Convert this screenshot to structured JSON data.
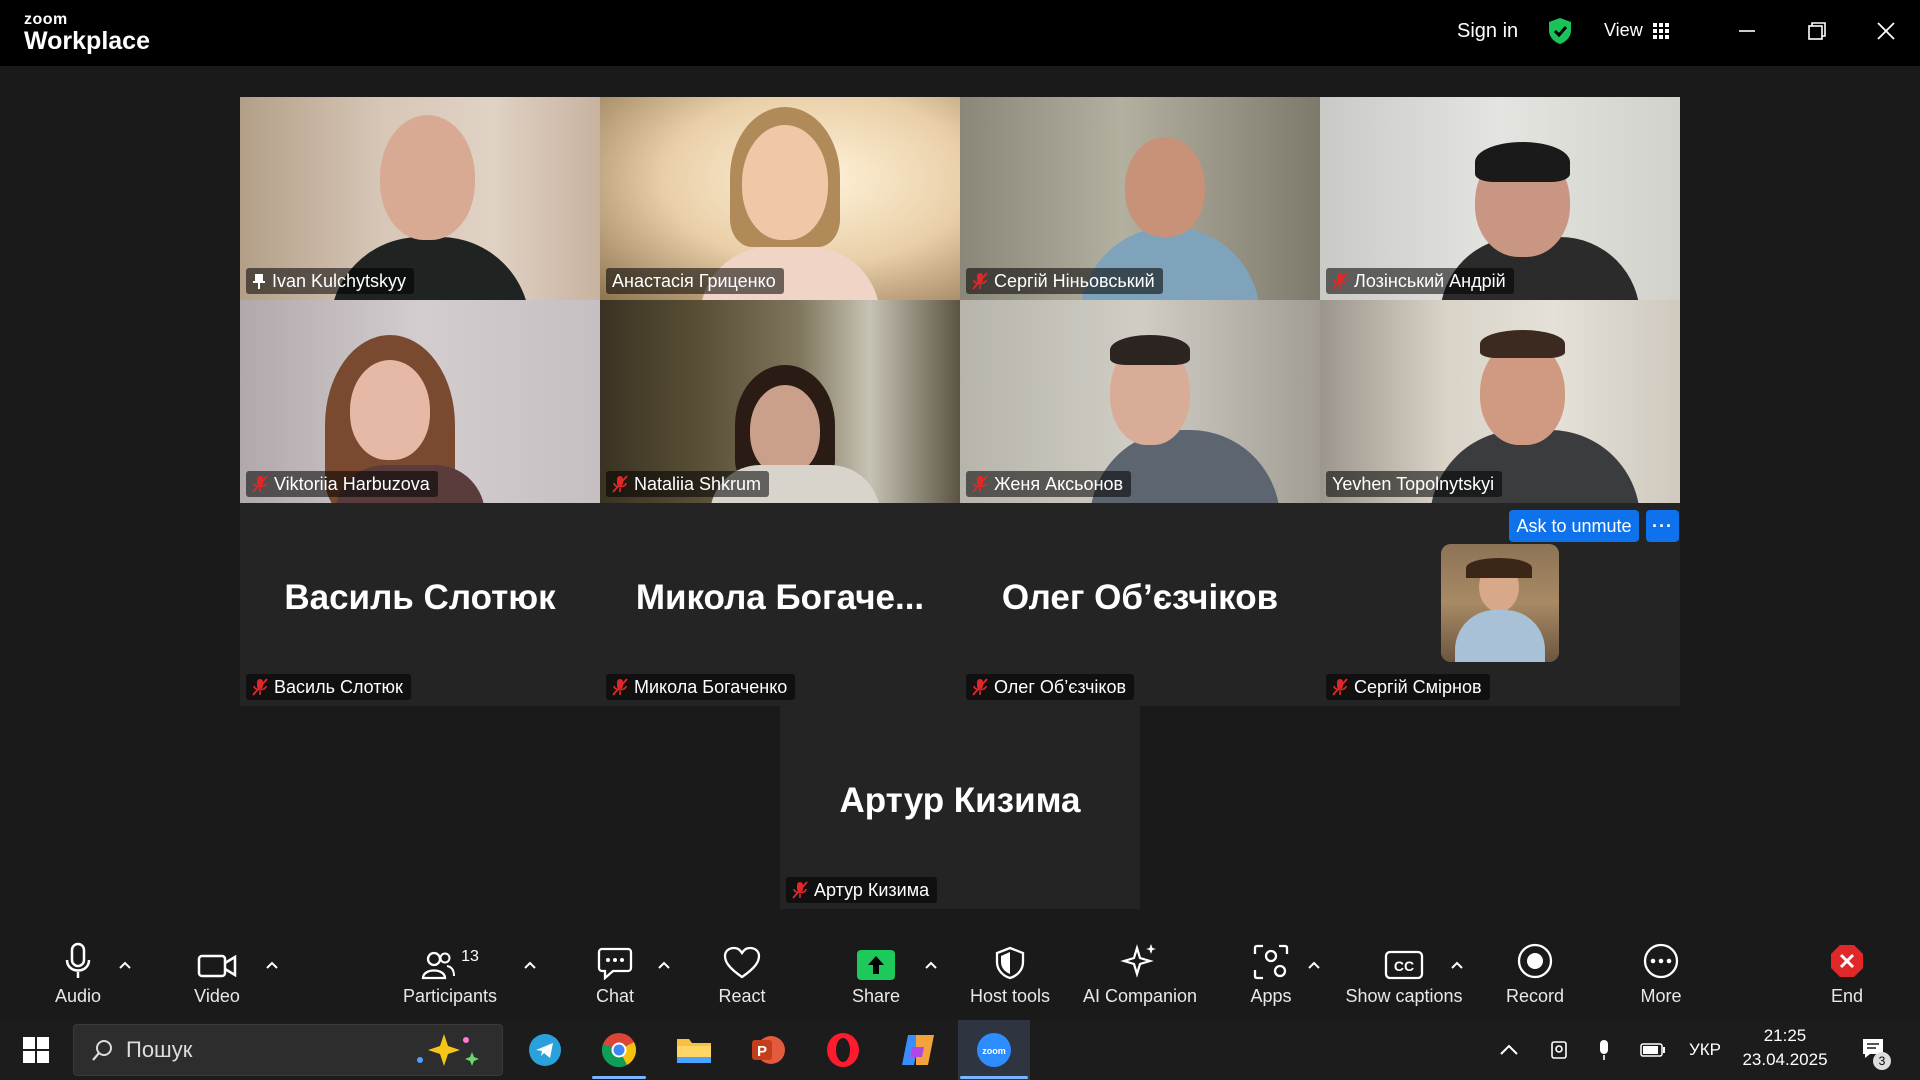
{
  "titlebar": {
    "logo_line1": "zoom",
    "logo_line2": "Workplace",
    "sign_in": "Sign in",
    "view_label": "View",
    "shield_color": "#19c35a"
  },
  "participants": [
    {
      "name": "Ivan Kulchytskyy",
      "icon": "pin-icon"
    },
    {
      "name": "Анастасія Гриценко",
      "icon": ""
    },
    {
      "name": "Сергій Ніньовський",
      "icon": "mic-muted-icon"
    },
    {
      "name": "Лозінський Андрій",
      "icon": "mic-muted-icon"
    },
    {
      "name": "Viktoriia Harbuzova",
      "icon": "mic-muted-icon"
    },
    {
      "name": "Nataliia Shkrum",
      "icon": "mic-muted-icon"
    },
    {
      "name": "Женя Аксьонов",
      "icon": "mic-muted-icon"
    },
    {
      "name": "Yevhen Topolnytskyi",
      "icon": "",
      "active_speaker": true
    },
    {
      "name": "Василь Слотюк",
      "display": "Василь Слотюк",
      "icon": "mic-muted-icon"
    },
    {
      "name": "Микола Богаченко",
      "display": "Микола  Богаче...",
      "icon": "mic-muted-icon"
    },
    {
      "name": "Олег Об’єзчіков",
      "display": "Олег Об’єзчіков",
      "icon": "mic-muted-icon"
    },
    {
      "name": "Сергій Смірнов",
      "icon": "mic-muted-icon"
    },
    {
      "name": "Артур Кизима",
      "display": "Артур Кизима",
      "icon": "mic-muted-icon"
    }
  ],
  "ask_to_unmute": "Ask to unmute",
  "more_dots": "···",
  "toolbar": {
    "audio": "Audio",
    "video": "Video",
    "participants": "Participants",
    "participants_count": "13",
    "chat": "Chat",
    "react": "React",
    "share": "Share",
    "host_tools": "Host tools",
    "ai_companion": "AI Companion",
    "apps": "Apps",
    "show_captions": "Show captions",
    "record": "Record",
    "more": "More",
    "end": "End",
    "share_color": "#1ec95b",
    "end_color": "#e02828"
  },
  "taskbar": {
    "search_placeholder": "Пошук",
    "language": "УКР",
    "time": "21:25",
    "date": "23.04.2025",
    "notifications": "3"
  }
}
